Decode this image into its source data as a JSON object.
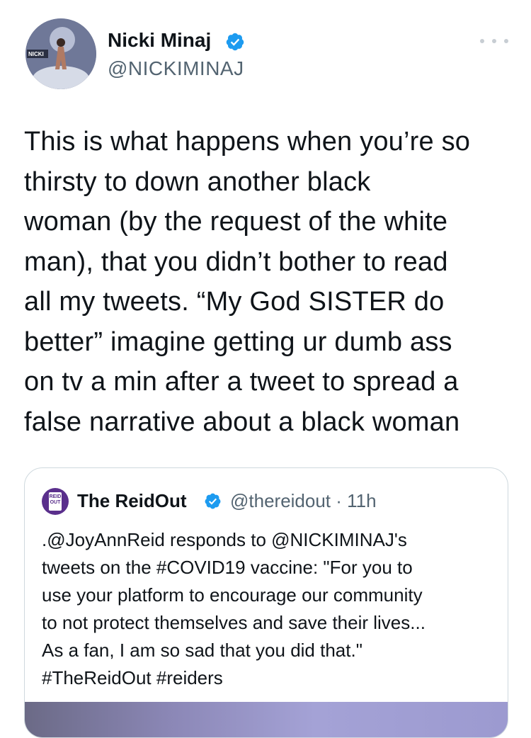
{
  "tweet": {
    "author_name": "Nicki Minaj",
    "author_handle": "@NICKIMINAJ",
    "text": "This is what happens when you’re so\nthirsty to down another black\nwoman (by the request of the white\nman), that you didn’t bother to read\nall my tweets. “My God SISTER do\nbetter” imagine getting ur dumb ass\non tv a min after a tweet to spread a\nfalse narrative about a black woman",
    "avatar_text": "NICKI MINAJ"
  },
  "quote": {
    "author_name": "The ReidOut",
    "handle_time": "@thereidout · 11h",
    "logo_text": "REID OUT",
    "text": ".@JoyAnnReid responds to @NICKIMINAJ's\ntweets on the #COVID19 vaccine: \"For you to\nuse your platform to encourage our community\nto not protect themselves and save their lives...\nAs a fan, I am so sad that you did that.\"\n#TheReidOut #reiders"
  },
  "icons": {
    "verified": "verified-badge-icon",
    "more": "more-options-icon"
  },
  "colors": {
    "verified_blue": "#1d9bf0",
    "secondary_text": "#536471",
    "border": "#cfd9de"
  }
}
